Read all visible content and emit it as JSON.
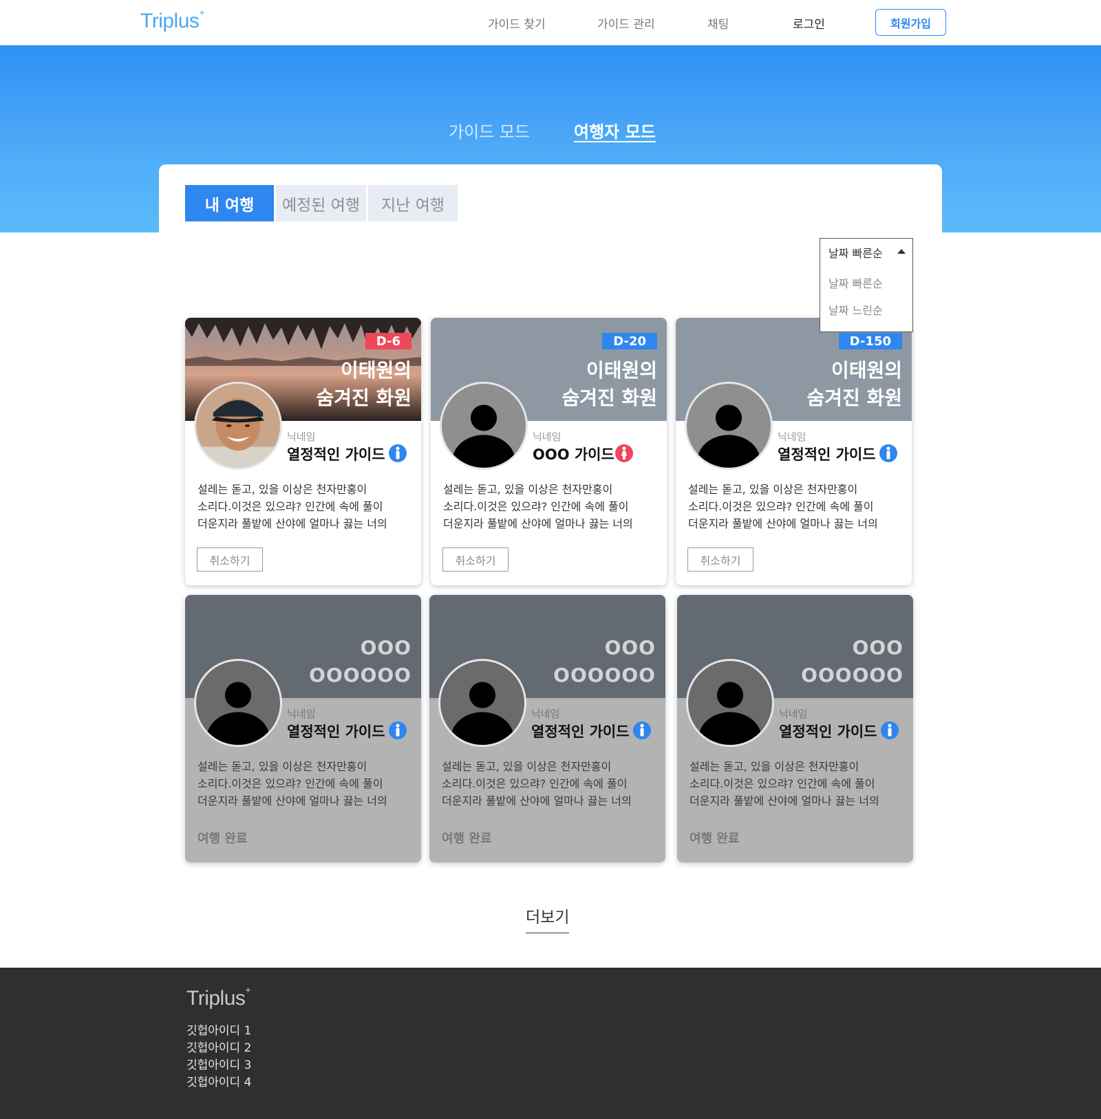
{
  "header": {
    "logo": "Triplus",
    "logo_sup": "+",
    "nav": [
      "가이드 찾기",
      "가이드 관리",
      "채팅"
    ],
    "login": "로그인",
    "signup": "회원가입"
  },
  "modes": {
    "guide": "가이드 모드",
    "traveler": "여행자 모드"
  },
  "tabs": [
    "내 여행",
    "예정된 여행",
    "지난 여행"
  ],
  "sort": {
    "selected": "날짜 빠른순",
    "options": [
      "날짜 빠른순",
      "날짜 느린순"
    ]
  },
  "cards": [
    {
      "dday": "D-6",
      "title": [
        "이태원의",
        "숨겨진 화원"
      ],
      "nick_label": "닉네임",
      "guide": "열정적인 가이드",
      "gender": "male",
      "desc": [
        "설레는 돋고, 있을 이상은 천자만홍이",
        "소리다.이것은 있으랴? 인간에 속에 풀이",
        "더운지라 풀밭에 산야에 얼마나 끓는 너의"
      ],
      "action": "취소하기"
    },
    {
      "dday": "D-20",
      "title": [
        "이태원의",
        "숨겨진 화원"
      ],
      "nick_label": "닉네임",
      "guide": "OOO 가이드",
      "gender": "female",
      "desc": [
        "설레는 돋고, 있을 이상은 천자만홍이",
        "소리다.이것은 있으랴? 인간에 속에 풀이",
        "더운지라 풀밭에 산야에 얼마나 끓는 너의"
      ],
      "action": "취소하기"
    },
    {
      "dday": "D-150",
      "title": [
        "이태원의",
        "숨겨진 화원"
      ],
      "nick_label": "닉네임",
      "guide": "열정적인 가이드",
      "gender": "male",
      "desc": [
        "설레는 돋고, 있을 이상은 천자만홍이",
        "소리다.이것은 있으랴? 인간에 속에 풀이",
        "더운지라 풀밭에 산야에 얼마나 끓는 너의"
      ],
      "action": "취소하기"
    },
    {
      "title": [
        "OOO",
        "OOOOOO"
      ],
      "nick_label": "닉네임",
      "guide": "열정적인 가이드",
      "gender": "male",
      "desc": [
        "설레는 돋고, 있을 이상은 천자만홍이",
        "소리다.이것은 있으랴? 인간에 속에 풀이",
        "더운지라 풀밭에 산야에 얼마나 끓는 너의"
      ],
      "status": "여행 완료"
    },
    {
      "title": [
        "OOO",
        "OOOOOO"
      ],
      "nick_label": "닉네임",
      "guide": "열정적인 가이드",
      "gender": "male",
      "desc": [
        "설레는 돋고, 있을 이상은 천자만홍이",
        "소리다.이것은 있으랴? 인간에 속에 풀이",
        "더운지라 풀밭에 산야에 얼마나 끓는 너의"
      ],
      "status": "여행 완료"
    },
    {
      "title": [
        "OOO",
        "OOOOOO"
      ],
      "nick_label": "닉네임",
      "guide": "열정적인 가이드",
      "gender": "male",
      "desc": [
        "설레는 돋고, 있을 이상은 천자만홍이",
        "소리다.이것은 있으랴? 인간에 속에 풀이",
        "더운지라 풀밭에 산야에 얼마나 끓는 너의"
      ],
      "status": "여행 완료"
    }
  ],
  "more": "더보기",
  "footer": {
    "logo": "Triplus",
    "logo_sup": "+",
    "links": [
      "깃헙아이디 1",
      "깃헙아이디 2",
      "깃헙아이디 3",
      "깃헙아이디 4"
    ]
  },
  "colors": {
    "accent": "#2e86f0",
    "dday_red": "#f0465a",
    "footer_bg": "#2f2f30"
  }
}
